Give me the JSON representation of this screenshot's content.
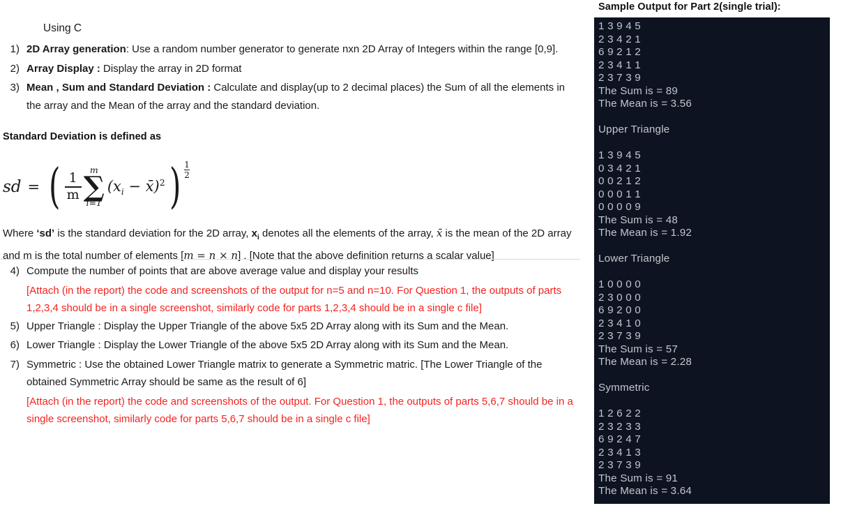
{
  "document": {
    "intro_heading": "Using C",
    "sd_definition_label": "Standard Deviation is defined as",
    "items_part1": [
      {
        "number": "1)",
        "bold": "2D Array generation",
        "text": ": Use a random number generator to generate nxn 2D Array of Integers within the range [0,9]."
      },
      {
        "number": "2)",
        "bold": "Array Display :",
        "text": " Display the array in 2D format"
      },
      {
        "number": "3)",
        "bold": "Mean , Sum and Standard Deviation :",
        "text": " Calculate and display(up to 2 decimal places) the Sum of all the elements in the array and the Mean of the array and the standard deviation."
      }
    ],
    "items_part2": [
      {
        "number": "4)",
        "bold": "",
        "text": "Compute the number of points that are above average value and display your results",
        "note": "[Attach (in the report) the code and screenshots of the output for n=5 and n=10. For Question 1, the outputs of parts 1,2,3,4 should be in a single screenshot, similarly code for parts 1,2,3,4 should be in a single c file]"
      },
      {
        "number": "5)",
        "bold": "",
        "text": "Upper Triangle : Display the Upper Triangle of the above 5x5 2D Array along with its Sum and the Mean.",
        "note": ""
      },
      {
        "number": "6)",
        "bold": "",
        "text": "Lower Triangle : Display the Lower Triangle of the above 5x5 2D Array along with its Sum and the Mean.",
        "note": ""
      },
      {
        "number": "7)",
        "bold": "",
        "text": "Symmetric : Use the obtained Lower Triangle matrix to generate a Symmetric matric. [The Lower Triangle of the obtained Symmetric Array should be same as the result of 6]",
        "note": "[Attach (in the report) the code and screenshots of the output. For Question 1, the outputs of parts 5,6,7 should be in a single screenshot, similarly code for parts 5,6,7 should be in a single c file]"
      }
    ],
    "formula": {
      "lhs": "sd",
      "equals": "=",
      "fraction_numerator": "1",
      "fraction_denominator": "m",
      "sigma_upper_limit": "m",
      "sigma_lower_limit": "i=1",
      "sigma": "∑",
      "summand_open": "(",
      "summand_x": "x",
      "summand_x_sub": "i",
      "summand_minus": "−",
      "summand_xbar": "x̄",
      "summand_close": ")",
      "summand_power": "2",
      "outer_exponent_num": "1",
      "outer_exponent_den": "2"
    },
    "where_paragraph": {
      "part1": "Where ",
      "bold1": "‘sd’",
      "part2": " is the standard deviation for the 2D array, ",
      "bold2": "x",
      "bold2_sub": "i",
      "part3": " denotes all the elements of the array, ",
      "math1": "x̄",
      "part4": " is the mean of the 2D array and m is the total number of elements [",
      "math2": "m = n × n",
      "part5": "] . [Note that the above definition returns a scalar value]"
    }
  },
  "terminal": {
    "title": "Sample Output for Part 2(single trial):",
    "lines": [
      "1 3 9 4 5",
      "2 3 4 2 1",
      "6 9 2 1 2",
      "2 3 4 1 1",
      "2 3 7 3 9",
      "The Sum is = 89",
      "The Mean is = 3.56",
      "",
      "Upper Triangle",
      "",
      "1 3 9 4 5",
      "0 3 4 2 1",
      "0 0 2 1 2",
      "0 0 0 1 1",
      "0 0 0 0 9",
      "The Sum is = 48",
      "The Mean is = 1.92",
      "",
      "Lower Triangle",
      "",
      "1 0 0 0 0",
      "2 3 0 0 0",
      "6 9 2 0 0",
      "2 3 4 1 0",
      "2 3 7 3 9",
      "The Sum is = 57",
      "The Mean is = 2.28",
      "",
      "Symmetric",
      "",
      "1 2 6 2 2",
      "2 3 2 3 3",
      "6 9 2 4 7",
      "2 3 4 1 3",
      "2 3 7 3 9",
      "The Sum is = 91",
      "The Mean is = 3.64"
    ]
  },
  "colors": {
    "terminal_bg": "#0d1320",
    "terminal_fg": "#c3c7cf",
    "note_red": "#f4231f",
    "body_text": "#1a1a1a",
    "rule": "#d9d9d9"
  }
}
